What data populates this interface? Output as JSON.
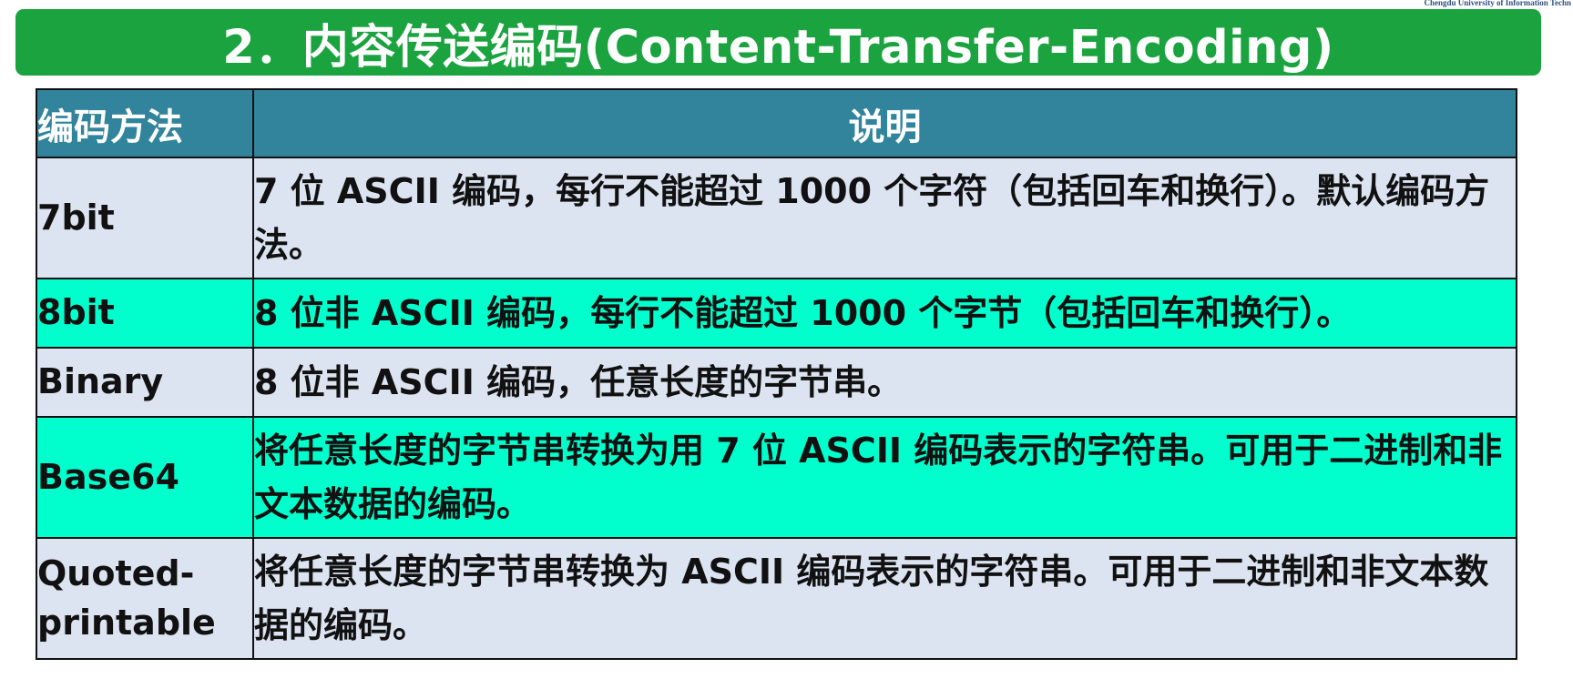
{
  "watermark": "Chengdu University of Information Techn",
  "title": "2．内容传送编码(Content-Transfer-Encoding)",
  "table": {
    "headers": {
      "method": "编码方法",
      "description": "说明"
    },
    "rows": [
      {
        "method": "7bit",
        "description": "7 位 ASCII 编码，每行不能超过 1000 个字符（包括回车和换行）。默认编码方法。",
        "highlight": "light"
      },
      {
        "method": "8bit",
        "description": "8 位非 ASCII 编码，每行不能超过 1000 个字节（包括回车和换行）。",
        "highlight": "cyan"
      },
      {
        "method": "Binary",
        "description": "8 位非 ASCII 编码，任意长度的字节串。",
        "highlight": "light"
      },
      {
        "method": "Base64",
        "description": "将任意长度的字节串转换为用 7 位 ASCII 编码表示的字符串。可用于二进制和非文本数据的编码。",
        "highlight": "cyan"
      },
      {
        "method": "Quoted-printable",
        "description": "将任意长度的字节串转换为 ASCII 编码表示的字符串。可用于二进制和非文本数据的编码。",
        "highlight": "light"
      }
    ]
  },
  "colors": {
    "title_bg": "#1aa33f",
    "header_bg": "#31849b",
    "row_light": "#dce3f1",
    "row_cyan": "#00ffcc"
  }
}
